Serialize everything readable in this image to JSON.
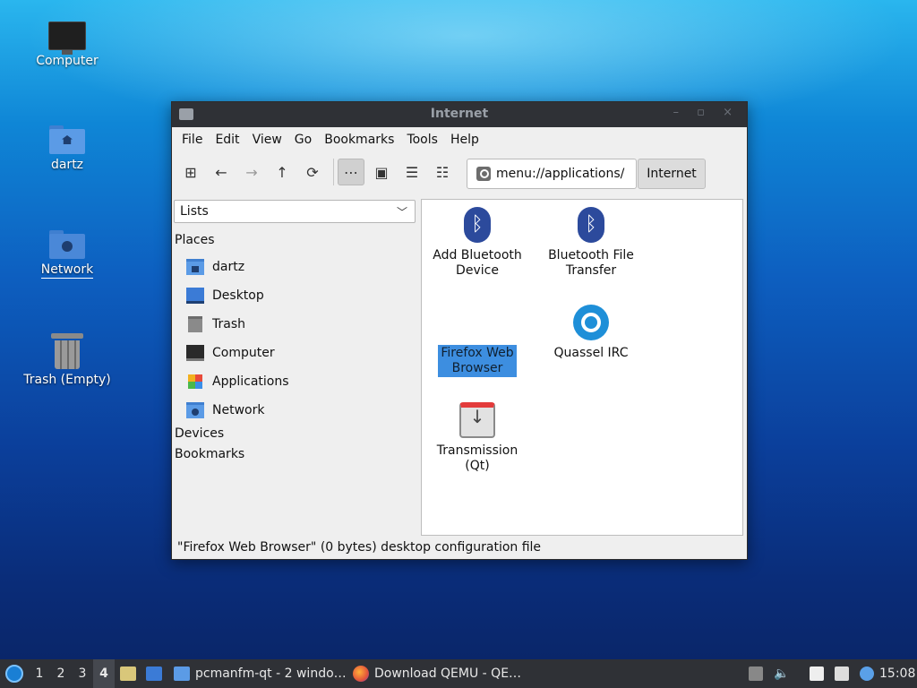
{
  "desktop": {
    "icons": [
      {
        "label": "Computer"
      },
      {
        "label": "dartz"
      },
      {
        "label": "Network"
      },
      {
        "label": "Trash (Empty)"
      }
    ]
  },
  "window": {
    "title": "Internet",
    "controls": "– ▫ ×",
    "menu": [
      "File",
      "Edit",
      "View",
      "Go",
      "Bookmarks",
      "Tools",
      "Help"
    ],
    "toolbar": {
      "new_tab": "⊞",
      "back": "←",
      "forward": "→",
      "up": "↑",
      "reload": "⟳",
      "icon_view": "⋯",
      "thumb_view": "▣",
      "compact_view": "☰",
      "detail_view": "☷"
    },
    "path": "menu://applications/",
    "breadcrumb": "Internet",
    "side": {
      "selector": "Lists",
      "sections": {
        "places": "Places",
        "devices": "Devices",
        "bookmarks": "Bookmarks"
      },
      "places": [
        "dartz",
        "Desktop",
        "Trash",
        "Computer",
        "Applications",
        "Network"
      ]
    },
    "items": [
      {
        "label_line1": "Add Bluetooth",
        "label_line2": "Device",
        "icon": "bluetooth-icon"
      },
      {
        "label_line1": "Bluetooth File",
        "label_line2": "Transfer",
        "icon": "bluetooth-icon"
      },
      {
        "label_line1": "Firefox Web",
        "label_line2": "Browser",
        "icon": "firefox-icon",
        "selected": true
      },
      {
        "label_line1": "Quassel IRC",
        "label_line2": "",
        "icon": "quassel-icon"
      },
      {
        "label_line1": "Transmission",
        "label_line2": "(Qt)",
        "icon": "transmission-icon"
      }
    ],
    "status": "\"Firefox Web Browser\" (0 bytes) desktop configuration file"
  },
  "taskbar": {
    "workspaces": [
      "1",
      "2",
      "3",
      "4"
    ],
    "active_workspace": "4",
    "tasks": [
      "pcmanfm-qt - 2 windo…",
      "Download QEMU - QE…"
    ],
    "clock": "15:08"
  },
  "colors": {
    "selection": "#3d8ee0",
    "titlebar": "#2f3136",
    "folder": "#5b9be6"
  }
}
